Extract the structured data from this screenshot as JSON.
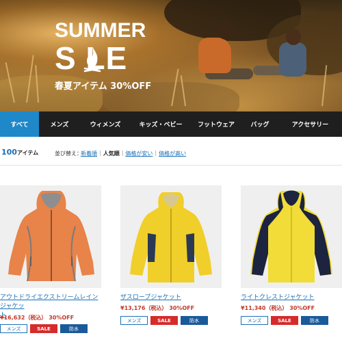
{
  "banner": {
    "title_line1": "SUMMER",
    "title_line2": "S  LE",
    "subtitle": "春夏アイテム 30%OFF"
  },
  "nav": {
    "items": [
      "すべて",
      "メンズ",
      "ウィメンズ",
      "キッズ・ベビー",
      "フットウェア",
      "バッグ",
      "アクセサリー"
    ],
    "active_index": 0
  },
  "listing": {
    "count": "100",
    "count_unit": "アイテム",
    "sort_label": "並び替え：",
    "sort_options": [
      "新着順",
      "人気順",
      "価格が安い",
      "価格が高い"
    ],
    "sort_current_index": 1
  },
  "products": [
    {
      "name_line1": "アウトドライエクストリームレインジャケッ",
      "name_line2": "ト",
      "price": "¥16,632（税込） 30%OFF",
      "tags": [
        "メンズ",
        "SALE",
        "防水"
      ],
      "color": "#e8834a"
    },
    {
      "name_line1": "ザスロープジャケット",
      "name_line2": "",
      "price": "¥13,176（税込） 30%OFF",
      "tags": [
        "メンズ",
        "SALE",
        "防水"
      ],
      "color": "#f0cf2a"
    },
    {
      "name_line1": "ライトクレストジャケット",
      "name_line2": "",
      "price": "¥11,340（税込） 30%OFF",
      "tags": [
        "メンズ",
        "SALE",
        "防水"
      ],
      "color": "#f2dc38"
    }
  ],
  "colors": {
    "accent": "#1e88c8",
    "nav_bg": "#1f1f1f",
    "link": "#1a6fb5",
    "sale": "#d62b2b"
  }
}
